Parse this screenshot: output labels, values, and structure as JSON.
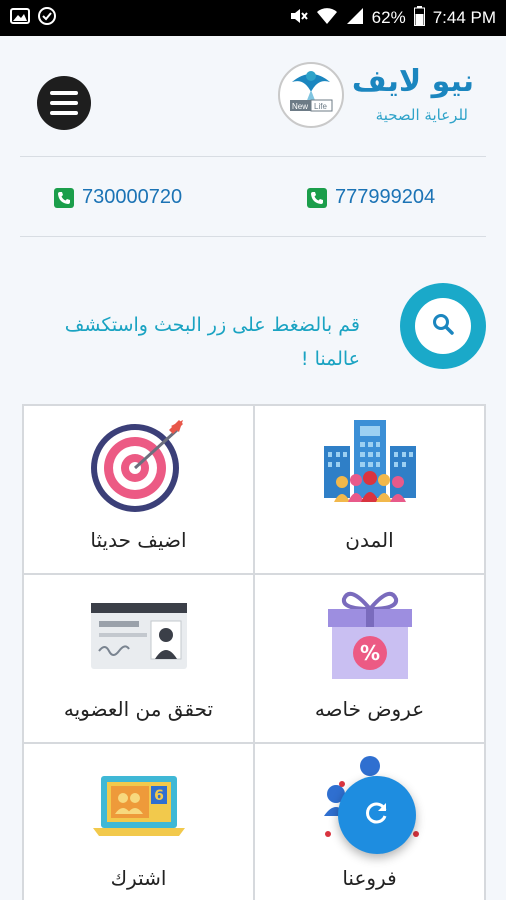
{
  "status_bar": {
    "battery": "62%",
    "time": "7:44 PM"
  },
  "header": {
    "brand_name": "نيو لايف",
    "brand_subtitle": "للرعاية الصحية",
    "logo_text": "NewLife"
  },
  "phones": [
    "777999204",
    "730000720"
  ],
  "search": {
    "prompt": "قم بالضغط على زر البحث واستكشف عالمنا !"
  },
  "grid": {
    "items": [
      {
        "label": "المدن",
        "icon": "city-buildings-icon"
      },
      {
        "label": "اضيف حديثا",
        "icon": "target-icon"
      },
      {
        "label": "عروض خاصه",
        "icon": "gift-percent-icon"
      },
      {
        "label": "تحقق من العضويه",
        "icon": "membership-card-icon"
      },
      {
        "label": "فروعنا",
        "icon": "branches-network-icon"
      },
      {
        "label": "اشترك",
        "icon": "laptop-subscribe-icon"
      }
    ]
  },
  "colors": {
    "accent": "#1aa9c9",
    "brand": "#1b86bf",
    "phone_icon": "#1b9e4b",
    "fab": "#1e8de0"
  }
}
